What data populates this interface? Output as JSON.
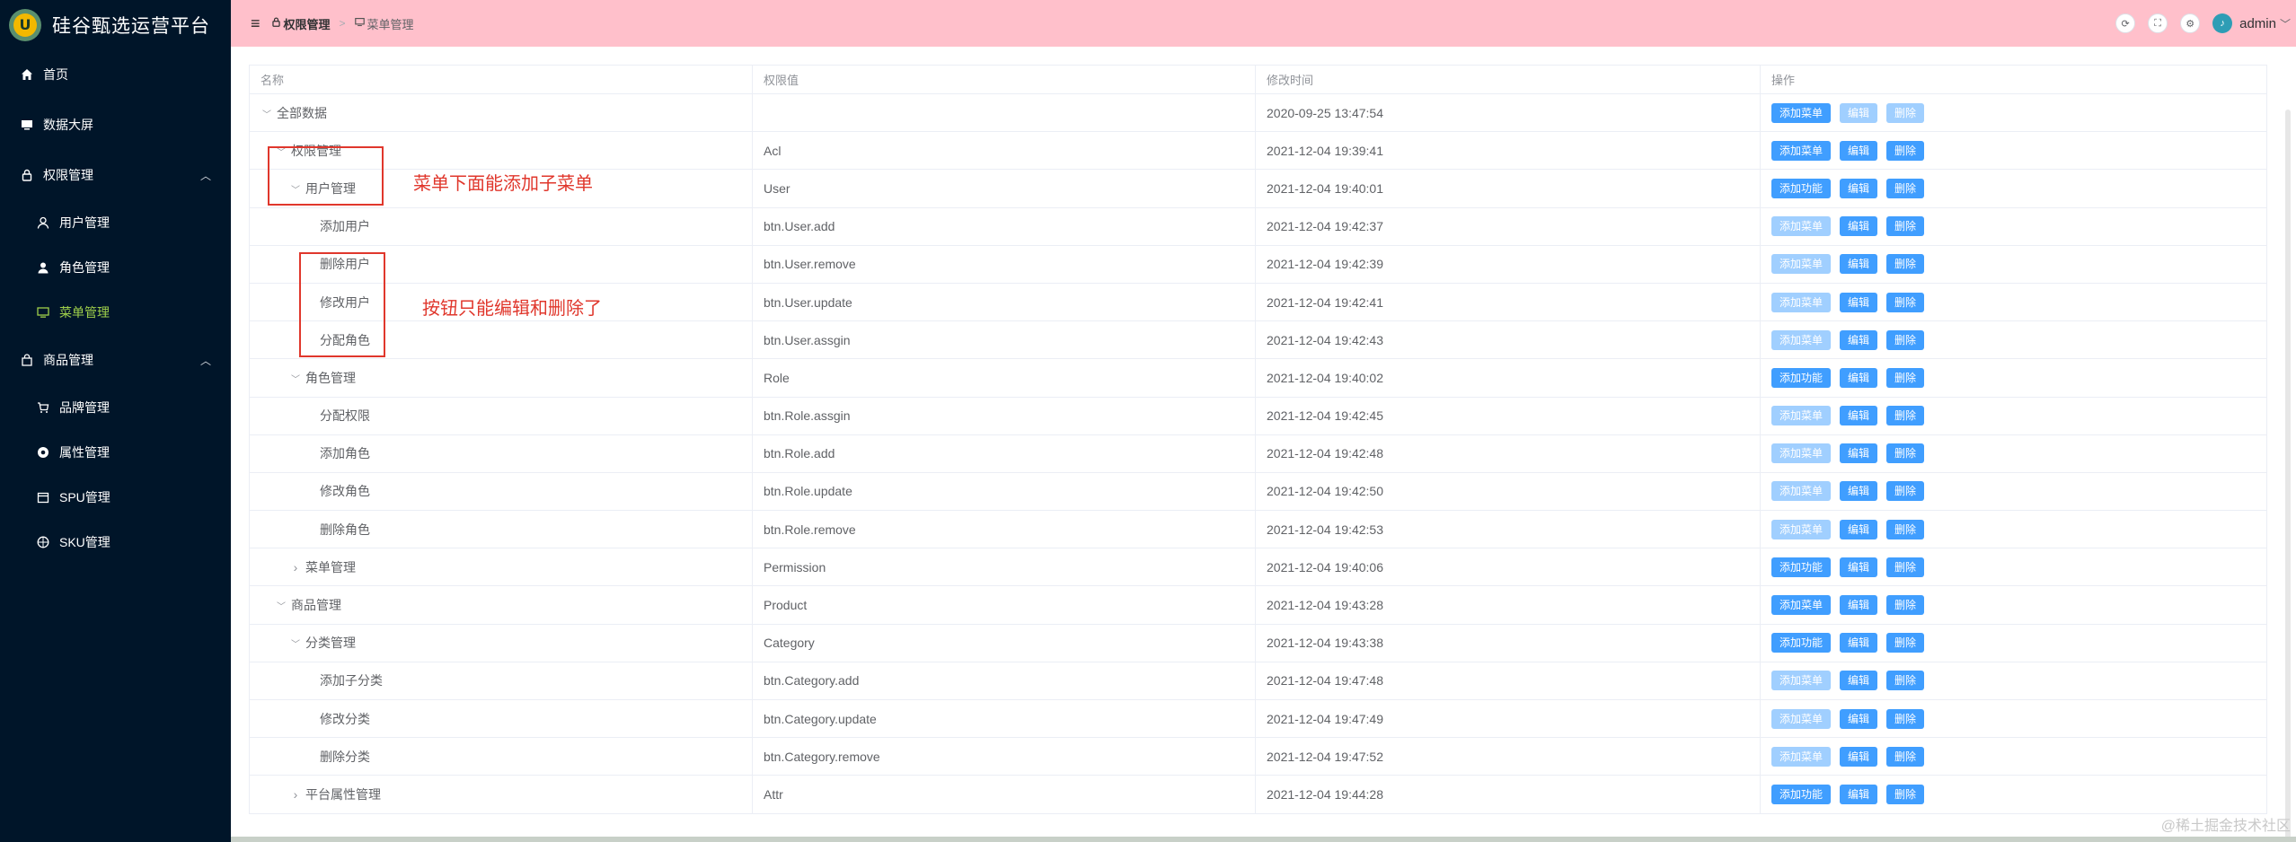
{
  "app": {
    "title": "硅谷甄选运营平台",
    "logo_letter": "U"
  },
  "sidebar": {
    "items": [
      {
        "label": "首页",
        "icon": "home-icon"
      },
      {
        "label": "数据大屏",
        "icon": "monitor-icon"
      },
      {
        "label": "权限管理",
        "icon": "lock-icon",
        "expanded": true,
        "children": [
          {
            "label": "用户管理",
            "icon": "user-icon"
          },
          {
            "label": "角色管理",
            "icon": "user-filled-icon"
          },
          {
            "label": "菜单管理",
            "icon": "monitor-icon",
            "active": true
          }
        ]
      },
      {
        "label": "商品管理",
        "icon": "shop-icon",
        "expanded": true,
        "children": [
          {
            "label": "品牌管理",
            "icon": "cart-icon"
          },
          {
            "label": "属性管理",
            "icon": "chrome-icon"
          },
          {
            "label": "SPU管理",
            "icon": "calendar-icon"
          },
          {
            "label": "SKU管理",
            "icon": "orange-icon"
          }
        ]
      }
    ],
    "active_color": "#9fd04b",
    "bg_color": "#001529"
  },
  "header": {
    "breadcrumb": [
      "权限管理",
      "菜单管理"
    ],
    "username": "admin",
    "bg_color": "#ffc0cb"
  },
  "table": {
    "columns": [
      "名称",
      "权限值",
      "修改时间",
      "操作"
    ],
    "buttons": {
      "add_menu": "添加菜单",
      "add_func": "添加功能",
      "edit": "编辑",
      "delete": "删除"
    },
    "rows": [
      {
        "name": "全部数据",
        "code": "",
        "time": "2020-09-25 13:47:54",
        "level": 0,
        "expander": "open",
        "add": "add_menu",
        "add_disabled": false,
        "edit_disabled": true,
        "delete_disabled": true
      },
      {
        "name": "权限管理",
        "code": "Acl",
        "time": "2021-12-04 19:39:41",
        "level": 1,
        "expander": "open",
        "add": "add_menu",
        "add_disabled": false,
        "edit_disabled": false,
        "delete_disabled": false
      },
      {
        "name": "用户管理",
        "code": "User",
        "time": "2021-12-04 19:40:01",
        "level": 2,
        "expander": "open",
        "add": "add_func",
        "add_disabled": false,
        "edit_disabled": false,
        "delete_disabled": false
      },
      {
        "name": "添加用户",
        "code": "btn.User.add",
        "time": "2021-12-04 19:42:37",
        "level": 3,
        "expander": "none",
        "add": "add_menu",
        "add_disabled": true,
        "edit_disabled": false,
        "delete_disabled": false
      },
      {
        "name": "删除用户",
        "code": "btn.User.remove",
        "time": "2021-12-04 19:42:39",
        "level": 3,
        "expander": "none",
        "add": "add_menu",
        "add_disabled": true,
        "edit_disabled": false,
        "delete_disabled": false
      },
      {
        "name": "修改用户",
        "code": "btn.User.update",
        "time": "2021-12-04 19:42:41",
        "level": 3,
        "expander": "none",
        "add": "add_menu",
        "add_disabled": true,
        "edit_disabled": false,
        "delete_disabled": false
      },
      {
        "name": "分配角色",
        "code": "btn.User.assgin",
        "time": "2021-12-04 19:42:43",
        "level": 3,
        "expander": "none",
        "add": "add_menu",
        "add_disabled": true,
        "edit_disabled": false,
        "delete_disabled": false
      },
      {
        "name": "角色管理",
        "code": "Role",
        "time": "2021-12-04 19:40:02",
        "level": 2,
        "expander": "open",
        "add": "add_func",
        "add_disabled": false,
        "edit_disabled": false,
        "delete_disabled": false
      },
      {
        "name": "分配权限",
        "code": "btn.Role.assgin",
        "time": "2021-12-04 19:42:45",
        "level": 3,
        "expander": "none",
        "add": "add_menu",
        "add_disabled": true,
        "edit_disabled": false,
        "delete_disabled": false
      },
      {
        "name": "添加角色",
        "code": "btn.Role.add",
        "time": "2021-12-04 19:42:48",
        "level": 3,
        "expander": "none",
        "add": "add_menu",
        "add_disabled": true,
        "edit_disabled": false,
        "delete_disabled": false
      },
      {
        "name": "修改角色",
        "code": "btn.Role.update",
        "time": "2021-12-04 19:42:50",
        "level": 3,
        "expander": "none",
        "add": "add_menu",
        "add_disabled": true,
        "edit_disabled": false,
        "delete_disabled": false
      },
      {
        "name": "删除角色",
        "code": "btn.Role.remove",
        "time": "2021-12-04 19:42:53",
        "level": 3,
        "expander": "none",
        "add": "add_menu",
        "add_disabled": true,
        "edit_disabled": false,
        "delete_disabled": false
      },
      {
        "name": "菜单管理",
        "code": "Permission",
        "time": "2021-12-04 19:40:06",
        "level": 2,
        "expander": "closed",
        "add": "add_func",
        "add_disabled": false,
        "edit_disabled": false,
        "delete_disabled": false
      },
      {
        "name": "商品管理",
        "code": "Product",
        "time": "2021-12-04 19:43:28",
        "level": 1,
        "expander": "open",
        "add": "add_menu",
        "add_disabled": false,
        "edit_disabled": false,
        "delete_disabled": false
      },
      {
        "name": "分类管理",
        "code": "Category",
        "time": "2021-12-04 19:43:38",
        "level": 2,
        "expander": "open",
        "add": "add_func",
        "add_disabled": false,
        "edit_disabled": false,
        "delete_disabled": false
      },
      {
        "name": "添加子分类",
        "code": "btn.Category.add",
        "time": "2021-12-04 19:47:48",
        "level": 3,
        "expander": "none",
        "add": "add_menu",
        "add_disabled": true,
        "edit_disabled": false,
        "delete_disabled": false
      },
      {
        "name": "修改分类",
        "code": "btn.Category.update",
        "time": "2021-12-04 19:47:49",
        "level": 3,
        "expander": "none",
        "add": "add_menu",
        "add_disabled": true,
        "edit_disabled": false,
        "delete_disabled": false
      },
      {
        "name": "删除分类",
        "code": "btn.Category.remove",
        "time": "2021-12-04 19:47:52",
        "level": 3,
        "expander": "none",
        "add": "add_menu",
        "add_disabled": true,
        "edit_disabled": false,
        "delete_disabled": false
      },
      {
        "name": "平台属性管理",
        "code": "Attr",
        "time": "2021-12-04 19:44:28",
        "level": 2,
        "expander": "closed",
        "add": "add_func",
        "add_disabled": false,
        "edit_disabled": false,
        "delete_disabled": false
      }
    ]
  },
  "annotations": {
    "menu_note": "菜单下面能添加子菜单",
    "button_note": "按钮只能编辑和删除了",
    "color": "#e0372c"
  },
  "watermark": "@稀土掘金技术社区"
}
